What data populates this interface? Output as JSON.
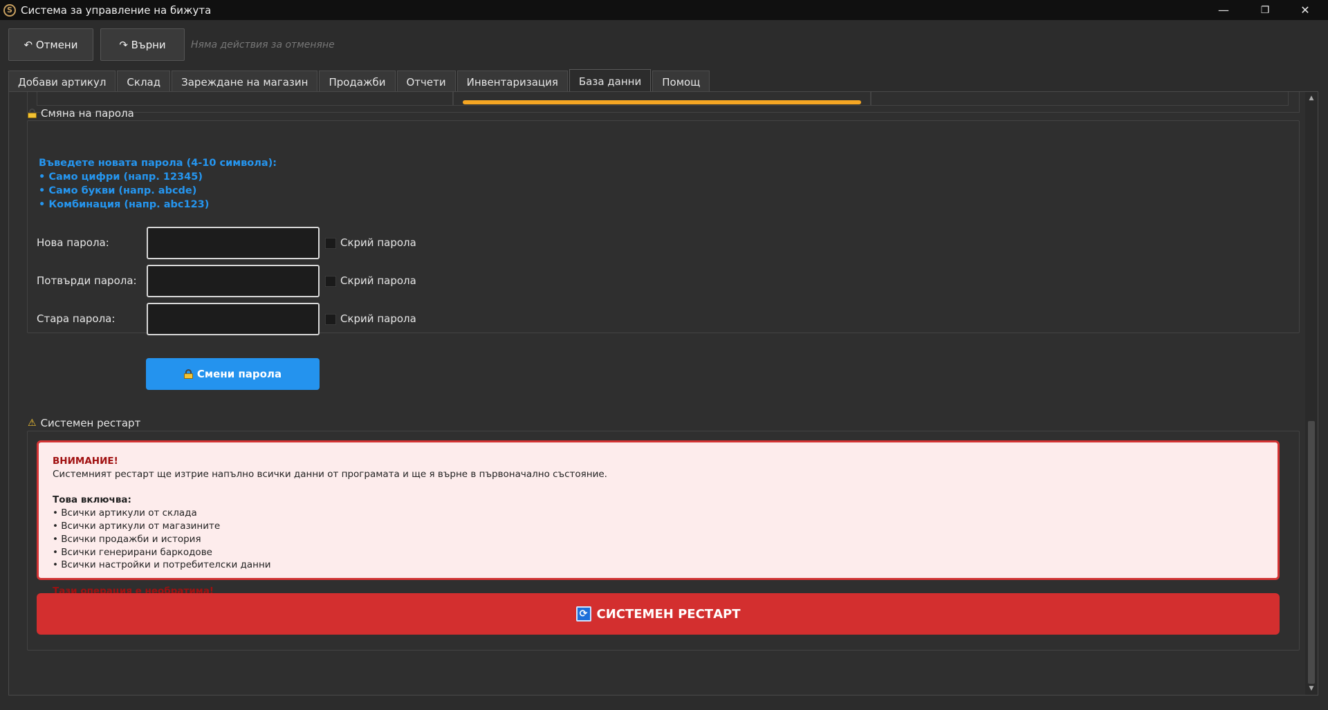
{
  "window": {
    "title": "Система за управление на бижута",
    "minimize_glyph": "—",
    "maximize_glyph": "❐",
    "close_glyph": "✕"
  },
  "toolbar": {
    "undo_label": "↶ Отмени",
    "redo_label": "↷ Върни",
    "undo_hint": "Няма действия за отменяне"
  },
  "tabs": [
    {
      "label": "Добави артикул"
    },
    {
      "label": "Склад"
    },
    {
      "label": "Зареждане на магазин"
    },
    {
      "label": "Продажби"
    },
    {
      "label": "Отчети"
    },
    {
      "label": "Инвентаризация"
    },
    {
      "label": "База данни",
      "active": true
    },
    {
      "label": "Помощ"
    }
  ],
  "password_section": {
    "title": "Смяна на парола",
    "hint_line1": "Въведете новата парола (4-10 символа):",
    "hint_line2": "• Само цифри (напр. 12345)",
    "hint_line3": "• Само букви (напр. abcde)",
    "hint_line4": "• Комбинация (напр. abc123)",
    "new_label": "Нова парола:",
    "confirm_label": "Потвърди парола:",
    "old_label": "Стара парола:",
    "hide_label": "Скрий парола",
    "new_value": "",
    "confirm_value": "",
    "old_value": "",
    "change_button": "Смени парола"
  },
  "restart_section": {
    "title": "Системен рестарт",
    "warning_title": "ВНИМАНИЕ!",
    "warning_text": "Системният рестарт ще изтрие напълно всички данни от програмата и ще я върне в първоначално състояние.",
    "includes_title": "Това включва:",
    "items": [
      "• Всички артикули от склада",
      "• Всички артикули от магазините",
      "• Всички продажби и история",
      "• Всички генерирани баркодове",
      "• Всички настройки и потребителски данни"
    ],
    "irreversible": "Тази операция е необратима!",
    "restart_button": "СИСТЕМЕН РЕСТАРТ"
  },
  "colors": {
    "accent_blue": "#2493ee",
    "danger_red": "#d32f2f",
    "warning_bg": "#fdecec",
    "orange": "#f5a623"
  }
}
